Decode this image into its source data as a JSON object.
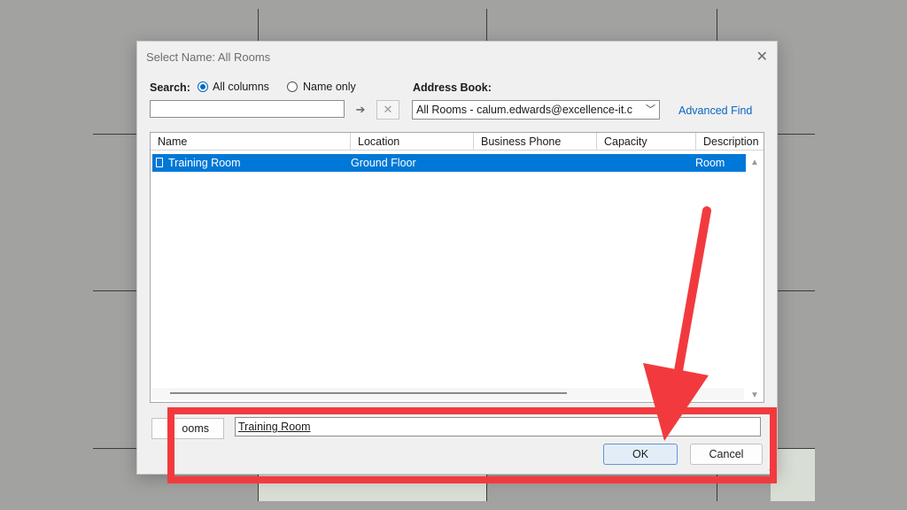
{
  "dialog": {
    "title": "Select Name: All Rooms"
  },
  "search": {
    "label": "Search:",
    "options": [
      "All columns",
      "Name only"
    ],
    "selected": "All columns",
    "value": ""
  },
  "address_book": {
    "label": "Address Book:",
    "value": "All Rooms - calum.edwards@excellence-it.c",
    "advanced_find": "Advanced Find"
  },
  "table": {
    "columns": [
      "Name",
      "Location",
      "Business Phone",
      "Capacity",
      "Description"
    ],
    "rows": [
      {
        "name": "Training Room",
        "location": "Ground Floor",
        "business_phone": "",
        "capacity": "",
        "description": "Room"
      }
    ]
  },
  "footer": {
    "rooms_button": "ooms",
    "rooms_value": "Training Room",
    "ok": "OK",
    "cancel": "Cancel"
  },
  "icons": {
    "close": "close-icon",
    "go": "arrow-right-icon",
    "clear": "clear-icon",
    "dropdown": "chevron-down-icon"
  },
  "colors": {
    "accent": "#0078d7",
    "annotation": "#f23a3e"
  }
}
